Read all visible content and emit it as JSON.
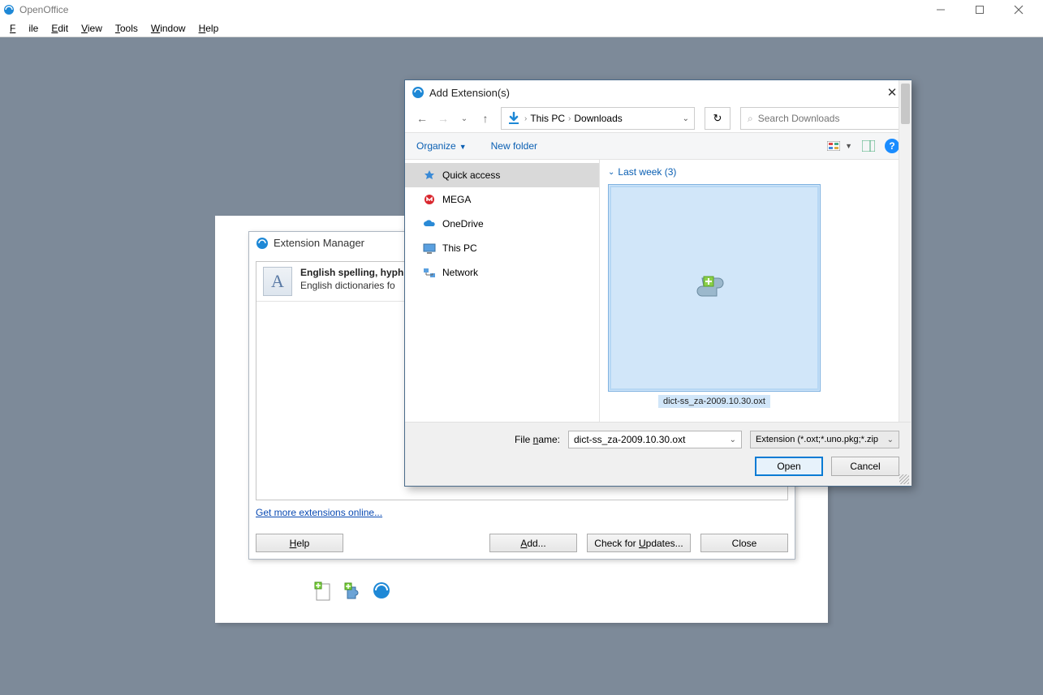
{
  "app": {
    "title": "OpenOffice",
    "menu": {
      "file": "File",
      "edit": "Edit",
      "view": "View",
      "tools": "Tools",
      "window": "Window",
      "help": "Help"
    }
  },
  "ext_mgr": {
    "title": "Extension Manager",
    "item": {
      "title": "English spelling, hyph",
      "desc": "English dictionaries fo"
    },
    "link": "Get more extensions online...",
    "buttons": {
      "help": "Help",
      "add": "Add...",
      "updates": "Check for Updates...",
      "close": "Close"
    }
  },
  "file_dlg": {
    "title": "Add Extension(s)",
    "breadcrumb": {
      "seg1": "This PC",
      "seg2": "Downloads"
    },
    "search_placeholder": "Search Downloads",
    "toolbar": {
      "organize": "Organize",
      "newfolder": "New folder"
    },
    "sidebar": {
      "quick": "Quick access",
      "mega": "MEGA",
      "onedrive": "OneDrive",
      "thispc": "This PC",
      "network": "Network"
    },
    "group": "Last week (3)",
    "selected_file": "dict-ss_za-2009.10.30.oxt",
    "file_name_label": "File name:",
    "file_name_value": "dict-ss_za-2009.10.30.oxt",
    "file_type": "Extension (*.oxt;*.uno.pkg;*.zip",
    "open": "Open",
    "cancel": "Cancel"
  }
}
